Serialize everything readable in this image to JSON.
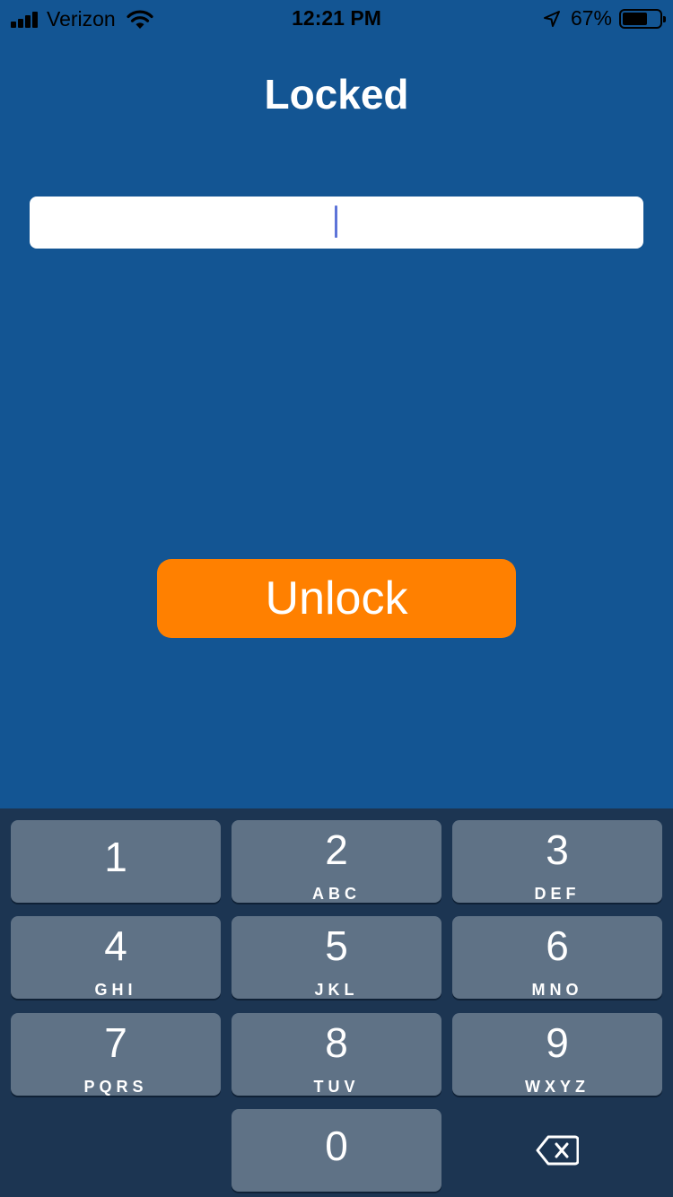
{
  "status_bar": {
    "carrier": "Verizon",
    "time": "12:21 PM",
    "battery_percent": "67%",
    "battery_level": 0.67,
    "icons": [
      "signal-icon",
      "wifi-icon",
      "location-icon",
      "battery-icon"
    ]
  },
  "title": "Locked",
  "passcode_input": {
    "value": ""
  },
  "unlock_button": {
    "label": "Unlock"
  },
  "keypad": {
    "keys": [
      {
        "digit": "1",
        "letters": ""
      },
      {
        "digit": "2",
        "letters": "ABC"
      },
      {
        "digit": "3",
        "letters": "DEF"
      },
      {
        "digit": "4",
        "letters": "GHI"
      },
      {
        "digit": "5",
        "letters": "JKL"
      },
      {
        "digit": "6",
        "letters": "MNO"
      },
      {
        "digit": "7",
        "letters": "PQRS"
      },
      {
        "digit": "8",
        "letters": "TUV"
      },
      {
        "digit": "9",
        "letters": "WXYZ"
      },
      {
        "digit": "0",
        "letters": ""
      }
    ],
    "delete_icon": "backspace-icon"
  },
  "colors": {
    "background": "#135593",
    "button": "#ff8000",
    "keypad_background": "#1c3552",
    "key": "#5f7286",
    "caret": "#5d74d8"
  }
}
